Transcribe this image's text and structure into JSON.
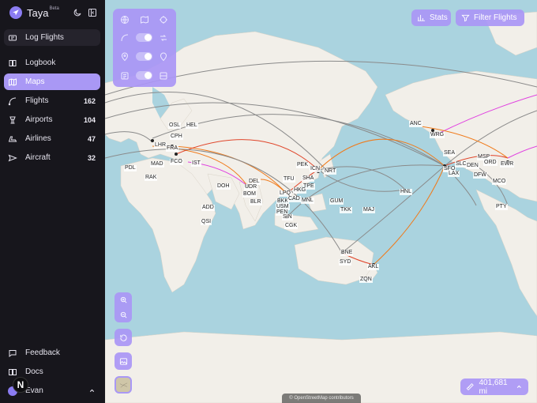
{
  "app": {
    "name": "Taya",
    "badge": "Beta"
  },
  "sidebar": {
    "log_flights": "Log Flights",
    "items": [
      {
        "label": "Logbook",
        "count": ""
      },
      {
        "label": "Maps",
        "count": ""
      },
      {
        "label": "Flights",
        "count": "162"
      },
      {
        "label": "Airports",
        "count": "104"
      },
      {
        "label": "Airlines",
        "count": "47"
      },
      {
        "label": "Aircraft",
        "count": "32"
      }
    ],
    "footer": {
      "feedback": "Feedback",
      "docs": "Docs",
      "user": "Evan",
      "avatar_letter": "N"
    }
  },
  "toolbar": {
    "stats": "Stats",
    "filter": "Filter Flights"
  },
  "distance": {
    "value": "401,681 mi"
  },
  "attribution": "© OpenStreetMap contributors",
  "airports": [
    "OSL",
    "HEL",
    "LHR",
    "CPH",
    "FRA",
    "MAD",
    "FCO",
    "IST",
    "PDL",
    "RAK",
    "DEL",
    "DOH",
    "UDR",
    "BOM",
    "BLR",
    "ADD",
    "QSI",
    "PEK",
    "ICN",
    "NRT",
    "TFU",
    "SHA",
    "TPE",
    "HKG",
    "LPQ",
    "BKK",
    "CAD",
    "MNL",
    "USM",
    "PEN",
    "SIN",
    "CGK",
    "GUM",
    "TKK",
    "MAJ",
    "HNL",
    "BNE",
    "SYD",
    "AKL",
    "ZQN",
    "ANC",
    "WRG",
    "SEA",
    "SFO",
    "SLC",
    "DEN",
    "LAX",
    "MSP",
    "ORD",
    "EWR",
    "DFW",
    "MCO",
    "PTY"
  ],
  "colors": {
    "accent": "#a998f5",
    "sidebar": "#17161c",
    "ocean": "#aad3df",
    "land": "#f2efe9",
    "route_grey": "#8a8a8a",
    "route_orange": "#f07a1a",
    "route_red": "#e0452a",
    "route_magenta": "#e040e0"
  }
}
